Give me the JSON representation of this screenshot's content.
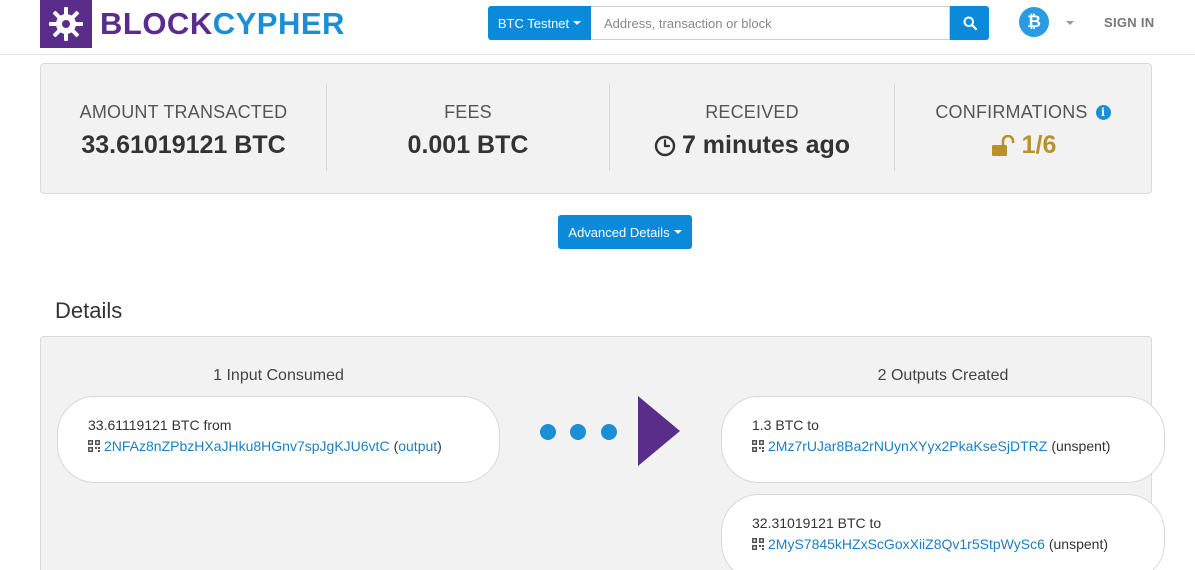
{
  "brand": {
    "name_part1": "BLOCK",
    "name_part2": "CYPHER",
    "accent": "#5a2d8a",
    "blue": "#1a8fd6"
  },
  "header": {
    "network_button": "BTC Testnet",
    "search_placeholder": "Address, transaction or block",
    "coin_icon": "bitcoin-icon",
    "coin_symbol": "₿",
    "sign_in": "SIGN IN"
  },
  "stats": {
    "amount_label": "AMOUNT TRANSACTED",
    "amount_value": "33.61019121 BTC",
    "fees_label": "FEES",
    "fees_value": "0.001 BTC",
    "received_label": "RECEIVED",
    "received_value": "7 minutes ago",
    "confirmations_label": "CONFIRMATIONS",
    "confirmations_value": "1/6",
    "confirmations_color": "#b8912a"
  },
  "advanced_button": "Advanced Details",
  "details": {
    "title": "Details",
    "inputs_title": "1 Input Consumed",
    "outputs_title": "2 Outputs Created",
    "inputs": [
      {
        "amount": "33.61119121 BTC from",
        "address": "2NFAz8nZPbzHXaJHku8HGnv7spJgKJU6vtC",
        "open": "(",
        "link": "output",
        "close": ")"
      }
    ],
    "outputs": [
      {
        "amount": "1.3 BTC to",
        "address": "2Mz7rUJar8Ba2rNUynXYyx2PkaKseSjDTRZ",
        "status": "(unspent)"
      },
      {
        "amount": "32.31019121 BTC to",
        "address": "2MyS7845kHZxScGoxXiiZ8Qv1r5StpWySc6",
        "status": "(unspent)"
      }
    ]
  }
}
